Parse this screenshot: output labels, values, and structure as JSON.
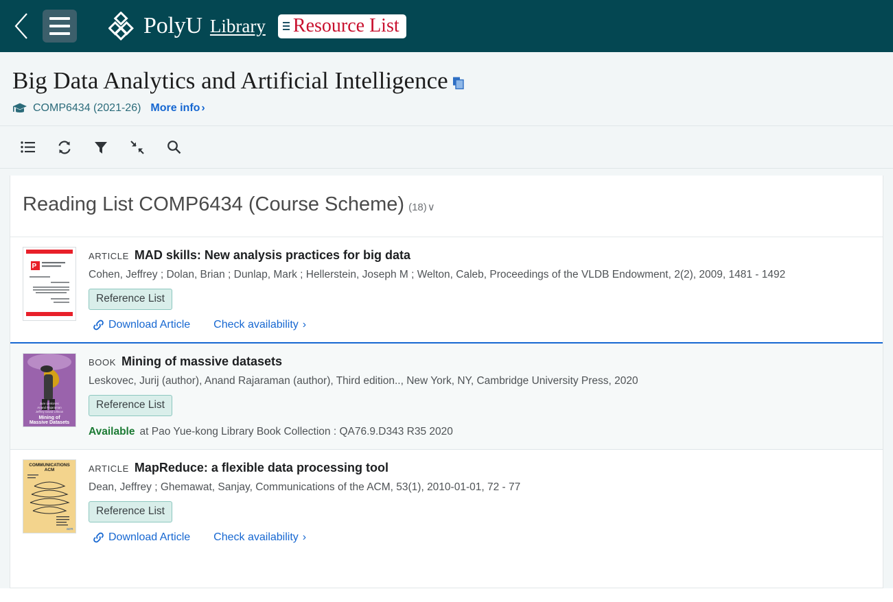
{
  "topbar": {
    "back_icon": "chevron-left-icon",
    "menu_icon": "hamburger-menu-icon",
    "brand_logo": "polyu-logo-icon",
    "brand_primary": "PolyU",
    "brand_secondary": "Library",
    "chip_label": "Resource List",
    "background_color": "#044752",
    "chip_text_color": "#c8102e"
  },
  "header": {
    "title": "Big Data Analytics and Artificial Intelligence",
    "copy_icon": "copy-icon",
    "cap_icon": "graduation-cap-icon",
    "course_code": "COMP6434 (2021-26)",
    "more_info_label": "More info",
    "more_info_chevron": "›"
  },
  "toolbar": {
    "items": [
      {
        "name": "list-view-icon",
        "title": "List view"
      },
      {
        "name": "refresh-icon",
        "title": "Refresh"
      },
      {
        "name": "filter-icon",
        "title": "Filter"
      },
      {
        "name": "collapse-icon",
        "title": "Collapse all"
      },
      {
        "name": "search-icon",
        "title": "Search"
      }
    ]
  },
  "section": {
    "title": "Reading List COMP6434 (Course Scheme)",
    "count": "(18)",
    "caret": "∨"
  },
  "items": [
    {
      "type": "ARTICLE",
      "title": "MAD skills: New analysis practices for big data",
      "meta": "Cohen, Jeffrey ; Dolan, Brian ; Dunlap, Mark ; Hellerstein, Joseph M ; Welton, Caleb,  Proceedings of the VLDB Endowment,  2(2),  2009,  1481 - 1492",
      "badge": "Reference List",
      "thumb": "vldb-proceedings-cover",
      "links": [
        {
          "name": "download-article-link",
          "label": "Download Article",
          "icon": "chain-link-icon"
        },
        {
          "name": "check-availability-link",
          "label": "Check availability",
          "icon": "chevron-right-icon"
        }
      ],
      "availability": null
    },
    {
      "type": "BOOK",
      "title": "Mining of massive datasets",
      "meta": "Leskovec, Jurij (author), Anand Rajaraman (author),  Third edition..,  New York, NY,  Cambridge University Press,  2020",
      "badge": "Reference List",
      "thumb": "mining-massive-datasets-cover",
      "links": [],
      "availability": {
        "status": "Available",
        "location": "at Pao Yue-kong Library Book Collection : QA76.9.D343 R35 2020"
      }
    },
    {
      "type": "ARTICLE",
      "title": "MapReduce: a flexible data processing tool",
      "meta": "Dean, Jeffrey ; Ghemawat, Sanjay,  Communications of the ACM,  53(1),  2010-01-01,  72 - 77",
      "badge": "Reference List",
      "thumb": "communications-acm-cover",
      "links": [
        {
          "name": "download-article-link",
          "label": "Download Article",
          "icon": "chain-link-icon"
        },
        {
          "name": "check-availability-link",
          "label": "Check availability",
          "icon": "chevron-right-icon"
        }
      ],
      "availability": null
    }
  ],
  "colors": {
    "header_teal": "#044752",
    "link_blue": "#1667d1",
    "badge_bg": "#d9eeea",
    "available_green": "#1b7a33",
    "page_bg": "#f2f6f7"
  }
}
